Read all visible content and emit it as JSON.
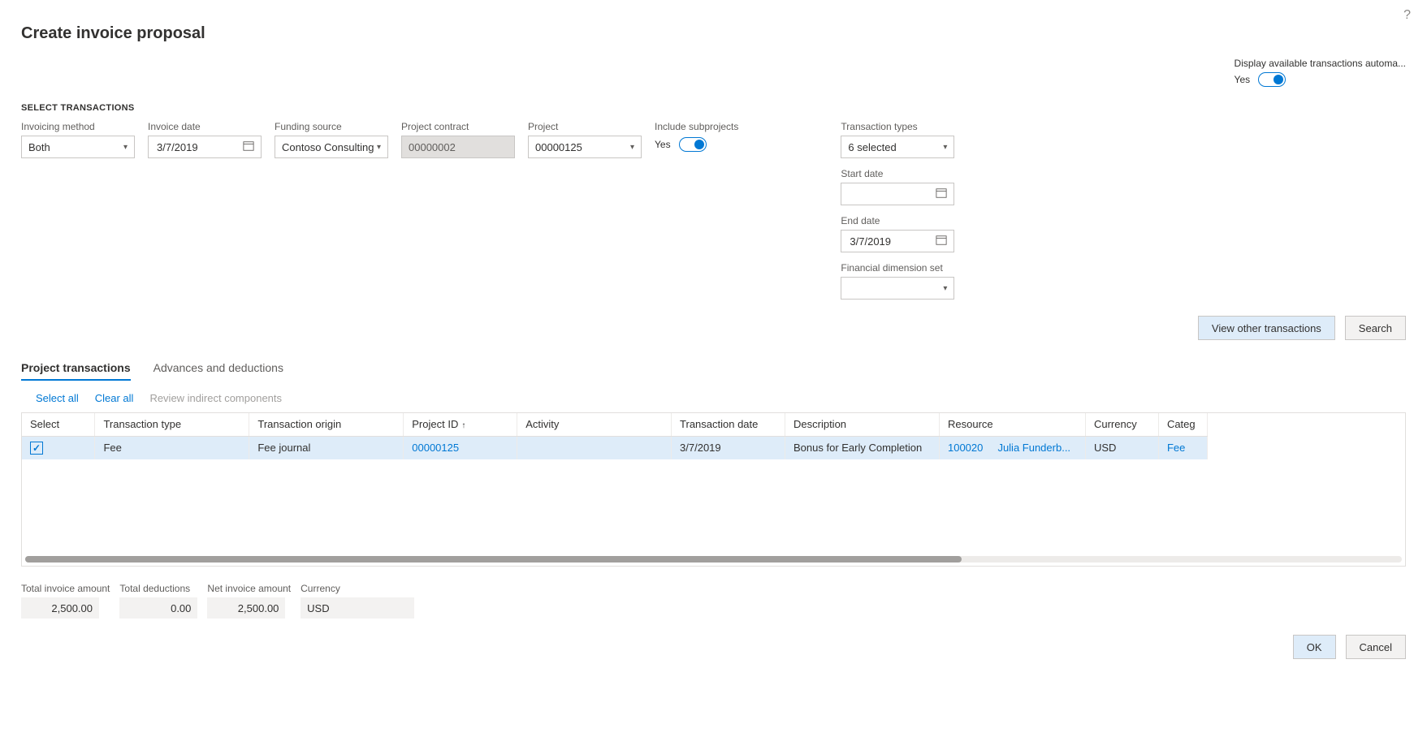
{
  "page": {
    "title": "Create invoice proposal",
    "help_tooltip": "?"
  },
  "display_toggle": {
    "label": "Display available transactions automa...",
    "value": "Yes"
  },
  "section_label": "SELECT TRANSACTIONS",
  "filters": {
    "invoicing_method": {
      "label": "Invoicing method",
      "value": "Both"
    },
    "invoice_date": {
      "label": "Invoice date",
      "value": "3/7/2019"
    },
    "funding_source": {
      "label": "Funding source",
      "value": "Contoso Consulting"
    },
    "project_contract": {
      "label": "Project contract",
      "value": "00000002"
    },
    "project": {
      "label": "Project",
      "value": "00000125"
    },
    "include_subprojects": {
      "label": "Include subprojects",
      "value": "Yes"
    },
    "transaction_types": {
      "label": "Transaction types",
      "value": "6 selected"
    },
    "start_date": {
      "label": "Start date",
      "value": ""
    },
    "end_date": {
      "label": "End date",
      "value": "3/7/2019"
    },
    "financial_dimension_set": {
      "label": "Financial dimension set",
      "value": ""
    }
  },
  "actions": {
    "view_other": "View other transactions",
    "search": "Search"
  },
  "tabs": {
    "project_transactions": "Project transactions",
    "advances_deductions": "Advances and deductions"
  },
  "grid_actions": {
    "select_all": "Select all",
    "clear_all": "Clear all",
    "review_indirect": "Review indirect components"
  },
  "grid": {
    "columns": {
      "select": "Select",
      "transaction_type": "Transaction type",
      "transaction_origin": "Transaction origin",
      "project_id": "Project ID",
      "activity": "Activity",
      "transaction_date": "Transaction date",
      "description": "Description",
      "resource": "Resource",
      "currency": "Currency",
      "category": "Categ"
    },
    "rows": [
      {
        "selected": true,
        "transaction_type": "Fee",
        "transaction_origin": "Fee journal",
        "project_id": "00000125",
        "activity": "",
        "transaction_date": "3/7/2019",
        "description": "Bonus for Early Completion",
        "resource_id": "100020",
        "resource_name": "Julia Funderb...",
        "currency": "USD",
        "category": "Fee"
      }
    ]
  },
  "totals": {
    "total_invoice_amount": {
      "label": "Total invoice amount",
      "value": "2,500.00"
    },
    "total_deductions": {
      "label": "Total deductions",
      "value": "0.00"
    },
    "net_invoice_amount": {
      "label": "Net invoice amount",
      "value": "2,500.00"
    },
    "currency": {
      "label": "Currency",
      "value": "USD"
    }
  },
  "footer": {
    "ok": "OK",
    "cancel": "Cancel"
  }
}
